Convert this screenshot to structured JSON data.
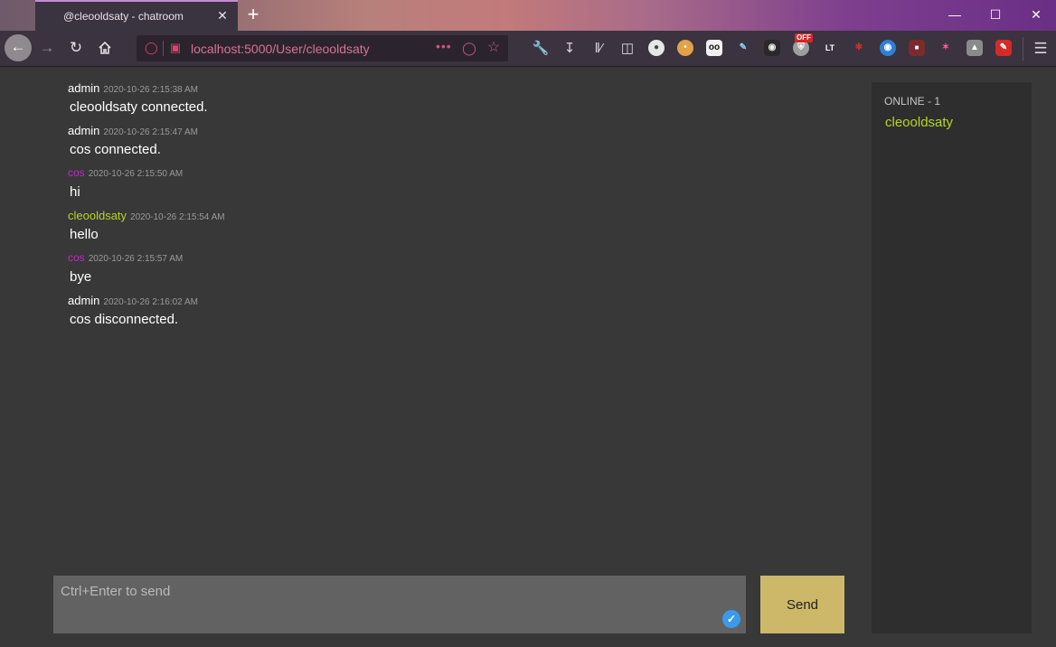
{
  "browser": {
    "tab_title": "@cleooldsaty - chatroom",
    "tab_close": "✕",
    "new_tab": "+",
    "win_minimize": "—",
    "win_maximize": "☐",
    "win_close": "✕",
    "url": "localhost:5000/User/cleooldsaty",
    "url_more": "•••",
    "off_badge": "OFF",
    "icons": {
      "back": "arrow-left-icon",
      "forward": "arrow-right-icon",
      "reload": "reload-icon",
      "home": "home-icon",
      "shield": "tracking-shield-icon",
      "page": "page-info-icon",
      "pocket": "pocket-icon",
      "star": "bookmark-star-icon",
      "wrench": "wrench-icon",
      "download": "download-icon",
      "library": "library-icon",
      "sidebar": "sidebar-icon",
      "menu": "hamburger-menu-icon"
    },
    "extensions": [
      "extension-disc-icon",
      "extension-palette-icon",
      "extension-eyes-icon",
      "extension-pen-icon",
      "extension-monkey-icon",
      "extension-shield-off-icon",
      "extension-lt-icon",
      "extension-bug-icon",
      "extension-globe-icon",
      "extension-gray-red-icon",
      "extension-asterisk-icon",
      "extension-wolf-icon",
      "extension-red-square-icon"
    ]
  },
  "chat": {
    "messages": [
      {
        "author": "admin",
        "time": "2020-10-26 2:15:38 AM",
        "text": "cleooldsaty connected."
      },
      {
        "author": "admin",
        "time": "2020-10-26 2:15:47 AM",
        "text": "cos connected."
      },
      {
        "author": "cos",
        "time": "2020-10-26 2:15:50 AM",
        "text": "hi"
      },
      {
        "author": "cleooldsaty",
        "time": "2020-10-26 2:15:54 AM",
        "text": "hello"
      },
      {
        "author": "cos",
        "time": "2020-10-26 2:15:57 AM",
        "text": "bye"
      },
      {
        "author": "admin",
        "time": "2020-10-26 2:16:02 AM",
        "text": "cos disconnected."
      }
    ],
    "composer_placeholder": "Ctrl+Enter to send",
    "send_label": "Send",
    "colors": {
      "admin": "#ffffff",
      "cos": "#c227c7",
      "cleooldsaty": "#b5d422",
      "send_button": "#cdb86a"
    }
  },
  "online": {
    "header": "ONLINE - 1",
    "users": [
      "cleooldsaty"
    ]
  }
}
